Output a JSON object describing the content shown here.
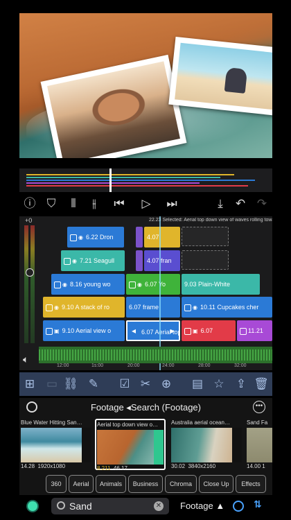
{
  "timeline": {
    "selection_info": "22.23  Selected: Aerial top down view of waves rolling towards beautiful san…",
    "meter_label": "+0",
    "clips": [
      {
        "id": "c1",
        "num": "6.22",
        "label": "Dron",
        "color": "#2b7ad6"
      },
      {
        "id": "c2",
        "num": "4.07",
        "label": "",
        "color": "#7b52c9"
      },
      {
        "id": "c3",
        "num": "4.07",
        "label": "",
        "color": "#e0b52b"
      },
      {
        "id": "c4",
        "num": "7.21",
        "label": "Seagull",
        "color": "#3bb8a8"
      },
      {
        "id": "c5",
        "num": "4.07",
        "label": "fran",
        "color": "#5a4ed0"
      },
      {
        "id": "c6",
        "num": "8.16",
        "label": "young wo",
        "color": "#2b7ad6"
      },
      {
        "id": "c7",
        "num": "6.07",
        "label": "Yo",
        "color": "#3fb33a"
      },
      {
        "id": "c8",
        "num": "9.03",
        "label": "Plain-White",
        "color": "#3bb8a8"
      },
      {
        "id": "c9",
        "num": "9.10",
        "label": "A stack of ro",
        "color": "#e0b52b"
      },
      {
        "id": "c10",
        "num": "6.07",
        "label": "frame",
        "color": "#2b7ad6"
      },
      {
        "id": "c11",
        "num": "10.11",
        "label": "Cupcakes cher",
        "color": "#2b7ad6"
      },
      {
        "id": "c12",
        "num": "9.10",
        "label": "Aerial view o",
        "color": "#2b7ad6"
      },
      {
        "id": "c13",
        "num": "6.07",
        "label": "Aerial top",
        "color": "#2b7ad6"
      },
      {
        "id": "c14",
        "num": "6.07",
        "label": "",
        "color": "#e23b48"
      },
      {
        "id": "c15",
        "num": "11.21",
        "label": "",
        "color": "#a84ad6"
      }
    ],
    "ruler": [
      "12:00",
      "1s:00",
      "20:00",
      "24:00",
      "28:00",
      "32:00"
    ]
  },
  "browser": {
    "title": "Footage ◂Search (Footage)",
    "cards": [
      {
        "title": "Blue Water Hitting San…",
        "duration": "14.28",
        "res": "1920x1080"
      },
      {
        "title": "Aerial top down view o…",
        "duration": "8.211",
        "res": "46.17"
      },
      {
        "title": "Australia aerial ocean…",
        "duration": "30.02",
        "res": "3840x2160"
      },
      {
        "title": "Sand Fa",
        "duration": "14.00",
        "res": "1"
      }
    ]
  },
  "chips": [
    "360",
    "Aerial",
    "Animals",
    "Business",
    "Chroma",
    "Close Up",
    "Effects"
  ],
  "search": {
    "value": "Sand",
    "placeholder": "Search",
    "scope": "Footage ▲"
  },
  "colors": {
    "accent": "#4aa3ff",
    "toolbar_bg": "#2f3d57",
    "status_green": "#3fe0b0"
  }
}
